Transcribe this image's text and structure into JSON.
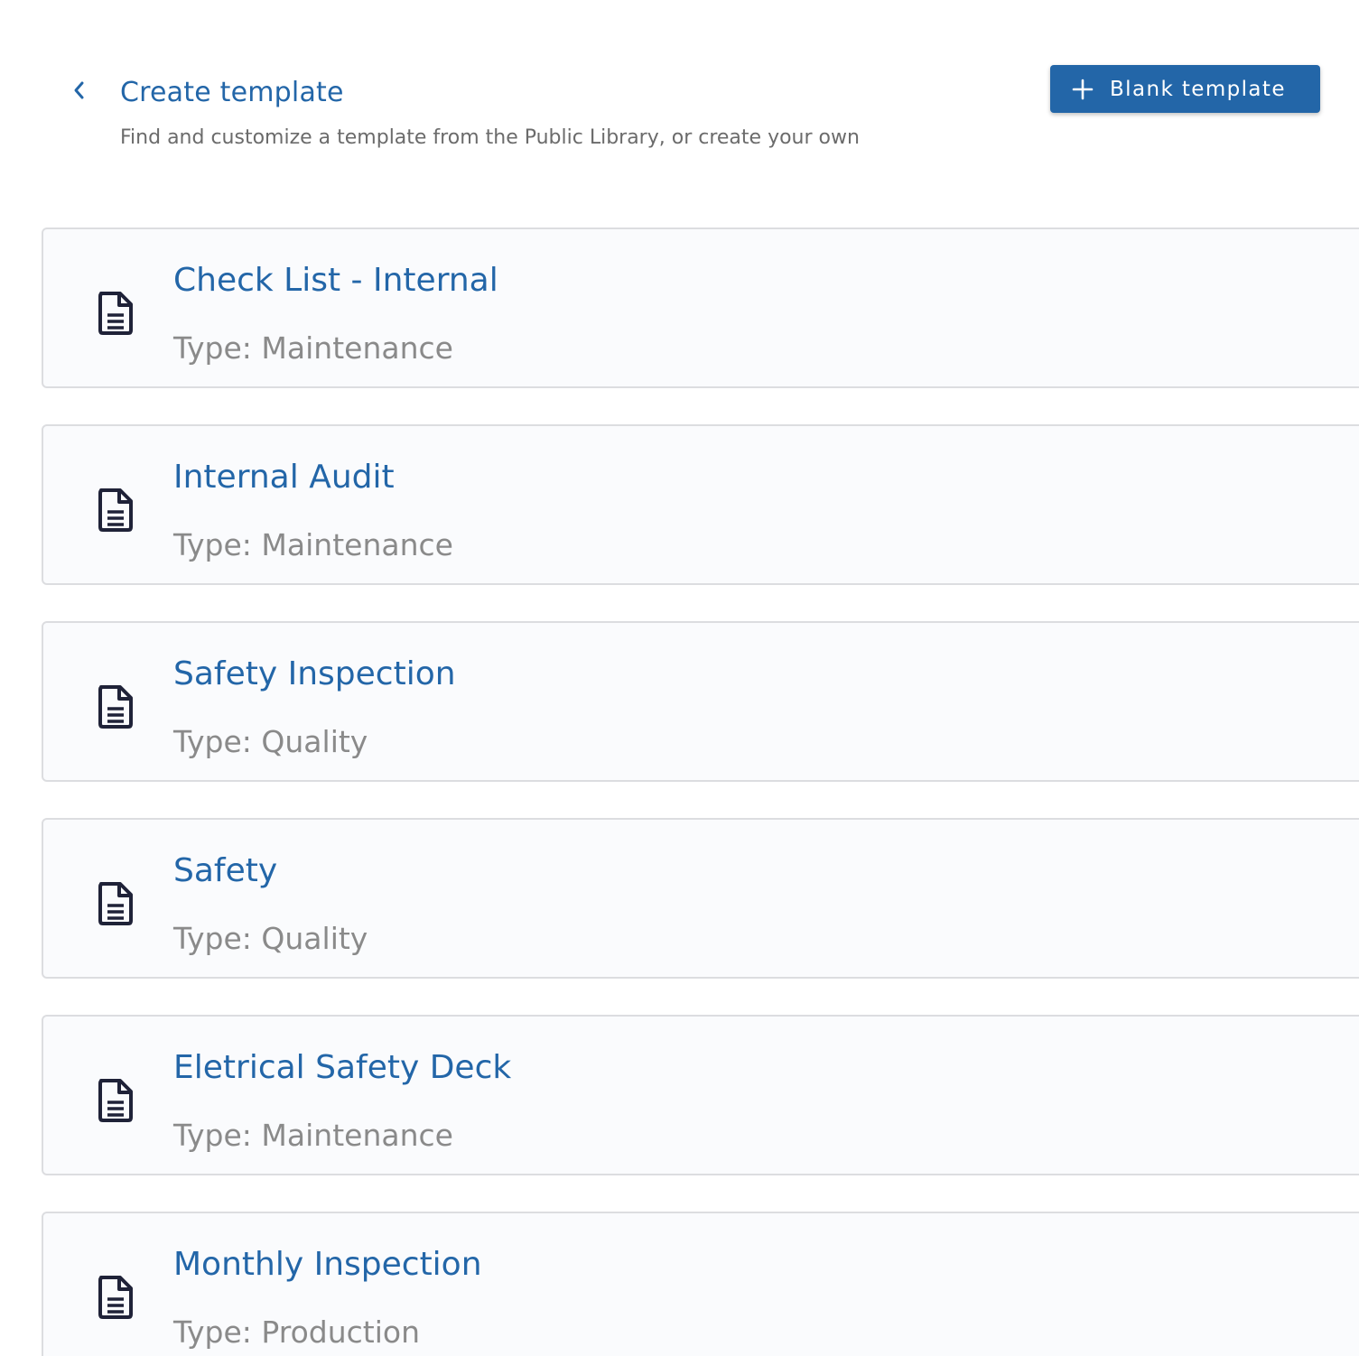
{
  "header": {
    "title": "Create template",
    "subtitle": "Find and customize a template from the Public Library, or create your own",
    "back_icon": "chevron-left-icon",
    "blank_button": {
      "label": "Blank template",
      "icon": "plus-icon"
    }
  },
  "colors": {
    "accent": "#2366a8",
    "card_background": "#fafbfd",
    "card_border": "#dcdde0",
    "muted_text": "#8a8a8a",
    "icon_dark": "#1f2238"
  },
  "templates": [
    {
      "title": "Check List - Internal",
      "type_label": "Type:",
      "type": "Maintenance",
      "icon": "document-icon"
    },
    {
      "title": "Internal Audit",
      "type_label": "Type:",
      "type": "Maintenance",
      "icon": "document-icon"
    },
    {
      "title": "Safety Inspection",
      "type_label": "Type:",
      "type": "Quality",
      "icon": "document-icon"
    },
    {
      "title": "Safety",
      "type_label": "Type:",
      "type": "Quality",
      "icon": "document-icon"
    },
    {
      "title": "Eletrical Safety Deck",
      "type_label": "Type:",
      "type": "Maintenance",
      "icon": "document-icon"
    },
    {
      "title": "Monthly Inspection",
      "type_label": "Type:",
      "type": "Production",
      "icon": "document-icon"
    }
  ]
}
